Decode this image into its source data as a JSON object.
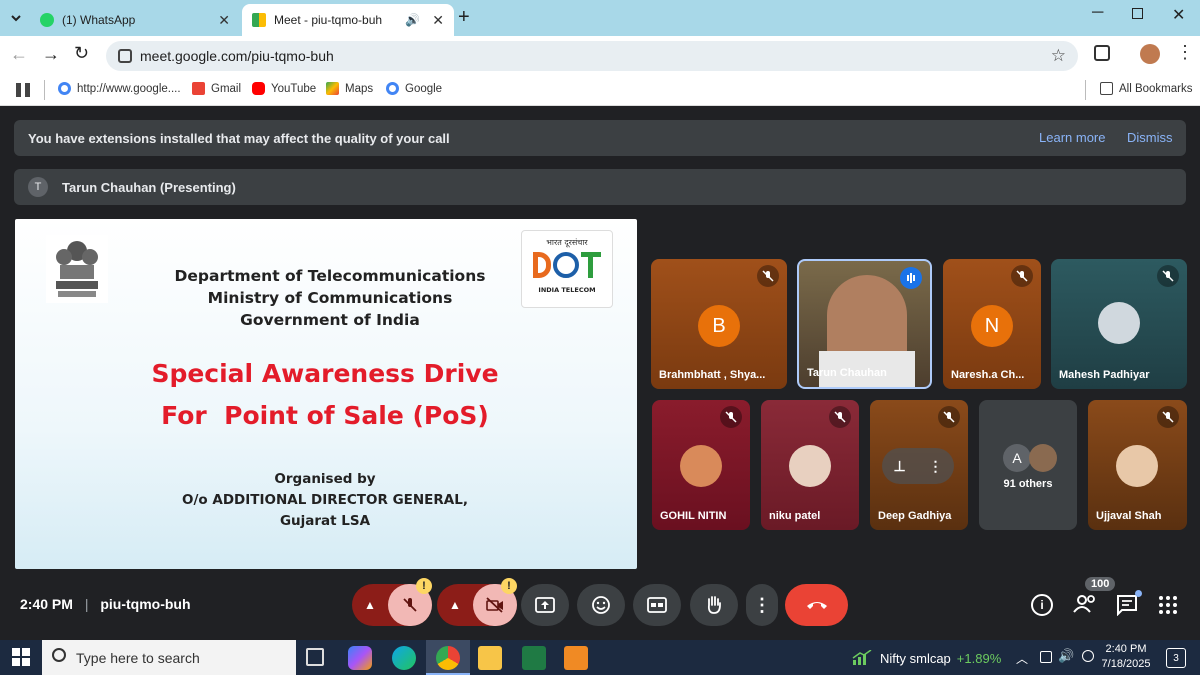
{
  "browser": {
    "tabs": [
      {
        "label": "(1) WhatsApp"
      },
      {
        "label": "Meet - piu-tqmo-buh"
      }
    ],
    "new_tab": "+",
    "url": "meet.google.com/piu-tqmo-buh",
    "bookmarks": [
      {
        "label": "http://www.google...."
      },
      {
        "label": "Gmail"
      },
      {
        "label": "YouTube"
      },
      {
        "label": "Maps"
      },
      {
        "label": "Google"
      }
    ],
    "all_bookmarks": "All Bookmarks"
  },
  "meet": {
    "ext_banner": {
      "text": "You have extensions installed that may affect the quality of your call",
      "learn_more": "Learn more",
      "dismiss": "Dismiss"
    },
    "presenting": {
      "initial": "T",
      "label": "Tarun Chauhan (Presenting)"
    },
    "slide": {
      "logo_text_top": "भारत दूरसंचार",
      "logo_text_bottom": "INDIA TELECOM",
      "dept": "Department of Telecommunications",
      "ministry": "Ministry of Communications",
      "govt": "Government of India",
      "title1": "Special Awareness Drive",
      "title2": "For  Point of Sale (PoS)",
      "organised": "Organised by",
      "office": "O/o ADDITIONAL DIRECTOR GENERAL,",
      "lsa": "Gujarat LSA"
    },
    "participants": [
      {
        "name": "Brahmbhatt , Shya...",
        "initial": "B"
      },
      {
        "name": "Tarun Chauhan"
      },
      {
        "name": "Naresh.a Ch...",
        "initial": "N"
      },
      {
        "name": "Mahesh Padhiyar"
      },
      {
        "name": "GOHIL NITIN"
      },
      {
        "name": "niku patel"
      },
      {
        "name": "Deep Gadhiya"
      },
      {
        "name": "91 others",
        "initial": "A"
      },
      {
        "name": "Ujjaval Shah"
      }
    ],
    "time": "2:40 PM",
    "separator": "|",
    "meeting_code": "piu-tqmo-buh",
    "warn_mark": "!",
    "people_count": "100"
  },
  "taskbar": {
    "search_placeholder": "Type here to search",
    "stock_name": "Nifty smlcap",
    "stock_change": "+1.89%",
    "time": "2:40 PM",
    "date": "7/18/2025",
    "notifications": "3"
  },
  "colors": {
    "accent": "#ea4335",
    "meet_bg": "#202124",
    "tab_strip": "#a8d8e8",
    "stock_green": "#6ccb5f"
  }
}
